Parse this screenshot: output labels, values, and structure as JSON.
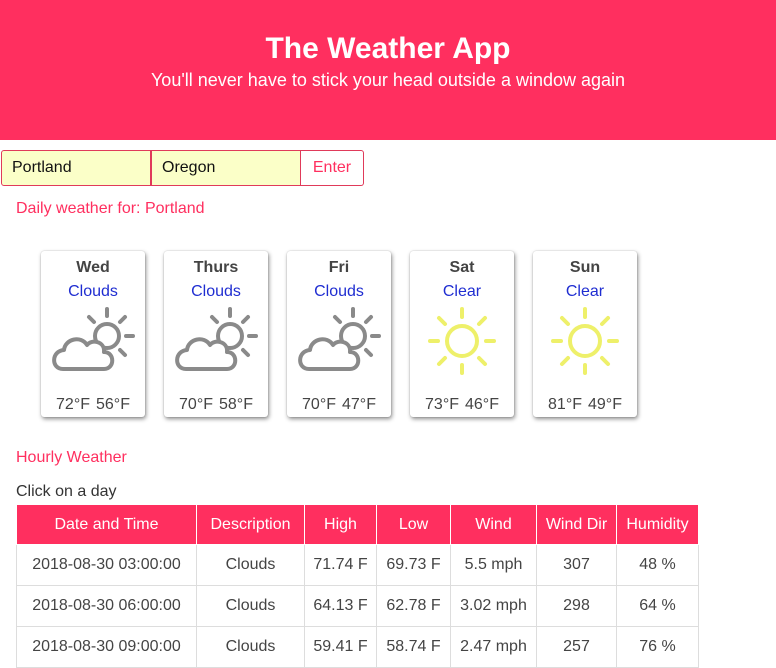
{
  "header": {
    "title": "The Weather App",
    "subtitle": "You'll never have to stick your head outside a window again"
  },
  "search": {
    "city_value": "Portland",
    "state_value": "Oregon",
    "submit_label": "Enter"
  },
  "daily": {
    "heading": "Daily weather for: Portland",
    "days": [
      {
        "name": "Wed",
        "description": "Clouds",
        "icon": "cloud-sun-icon",
        "high": "72°F",
        "low": "56°F"
      },
      {
        "name": "Thurs",
        "description": "Clouds",
        "icon": "cloud-sun-icon",
        "high": "70°F",
        "low": "58°F"
      },
      {
        "name": "Fri",
        "description": "Clouds",
        "icon": "cloud-sun-icon",
        "high": "70°F",
        "low": "47°F"
      },
      {
        "name": "Sat",
        "description": "Clear",
        "icon": "sun-icon",
        "high": "73°F",
        "low": "46°F"
      },
      {
        "name": "Sun",
        "description": "Clear",
        "icon": "sun-icon",
        "high": "81°F",
        "low": "49°F"
      }
    ]
  },
  "hourly": {
    "heading": "Hourly Weather",
    "note": "Click on a day",
    "columns": [
      "Date and Time",
      "Description",
      "High",
      "Low",
      "Wind",
      "Wind Dir",
      "Humidity"
    ],
    "rows": [
      [
        "2018-08-30 03:00:00",
        "Clouds",
        "71.74 F",
        "69.73 F",
        "5.5 mph",
        "307",
        "48 %"
      ],
      [
        "2018-08-30 06:00:00",
        "Clouds",
        "64.13 F",
        "62.78 F",
        "3.02 mph",
        "298",
        "64 %"
      ],
      [
        "2018-08-30 09:00:00",
        "Clouds",
        "59.41 F",
        "58.74 F",
        "2.47 mph",
        "257",
        "76 %"
      ]
    ]
  },
  "colors": {
    "accent": "#ff2f5f",
    "input_bg": "#fbffc8",
    "desc_blue": "#1f2dd1",
    "cloud_gray": "#8a8a8a",
    "sun_yellow": "#eef06a"
  }
}
